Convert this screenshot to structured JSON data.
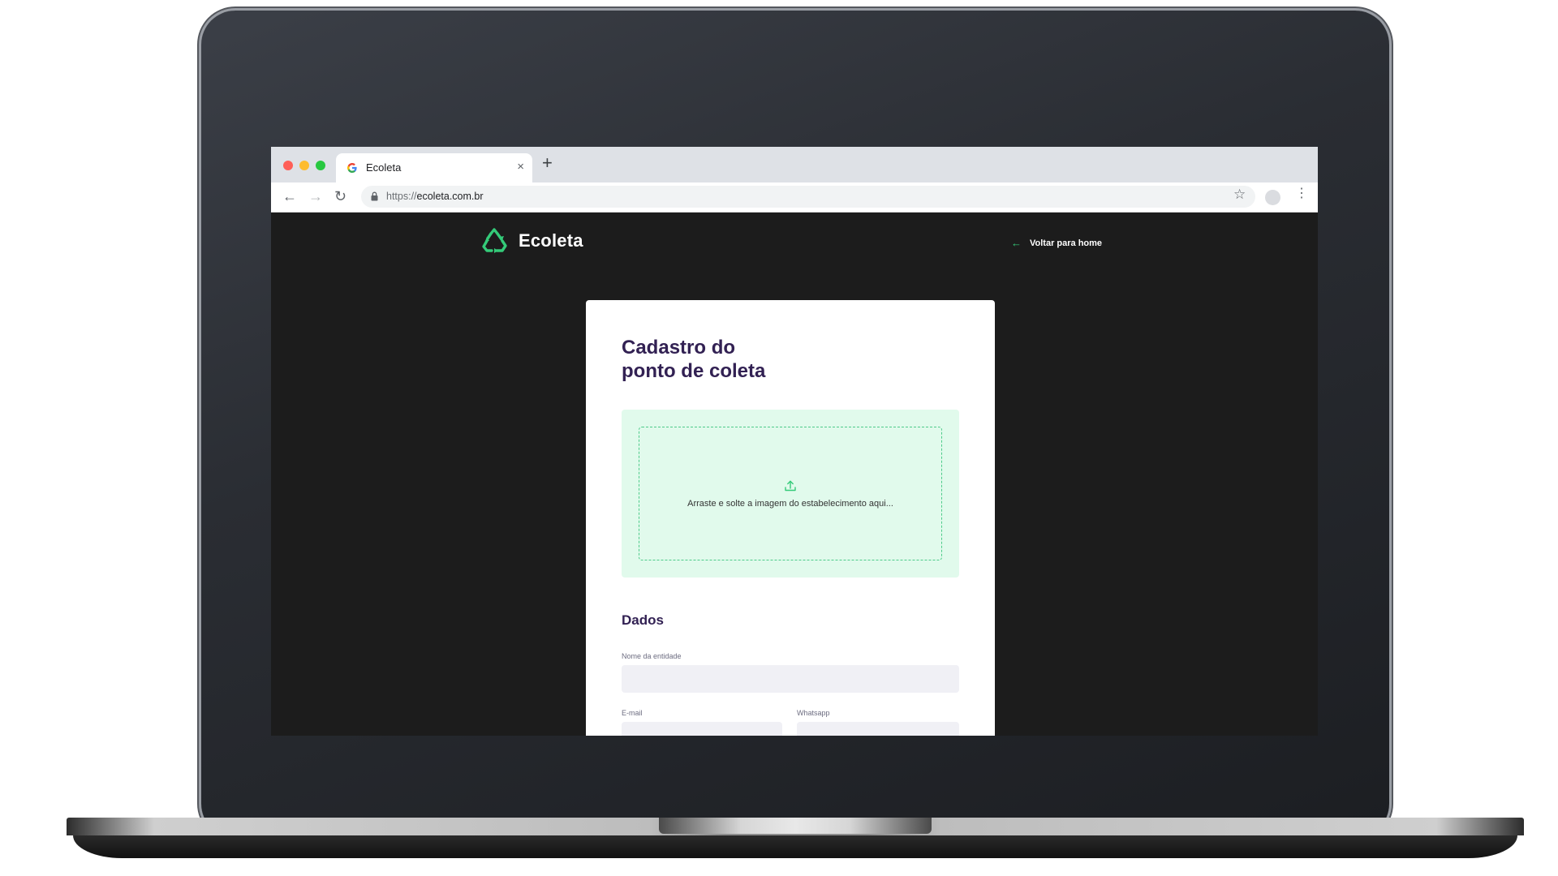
{
  "browser": {
    "tab_title": "Ecoleta",
    "new_tab_symbol": "+",
    "close_symbol": "×",
    "url_scheme": "https://",
    "url_host": "ecoleta.com.br"
  },
  "header": {
    "logo_text": "Ecoleta",
    "back_link": "Voltar para home"
  },
  "form": {
    "title_line1": "Cadastro do",
    "title_line2": "ponto de coleta",
    "dropzone_text": "Arraste e solte a imagem do estabelecimento aqui...",
    "section_title": "Dados",
    "fields": {
      "name_label": "Nome da entidade",
      "email_label": "E-mail",
      "whatsapp_label": "Whatsapp"
    }
  },
  "colors": {
    "accent": "#34cb79",
    "title": "#322153",
    "dropzone_bg": "#e1faec",
    "page_bg": "#1c1c1c"
  }
}
